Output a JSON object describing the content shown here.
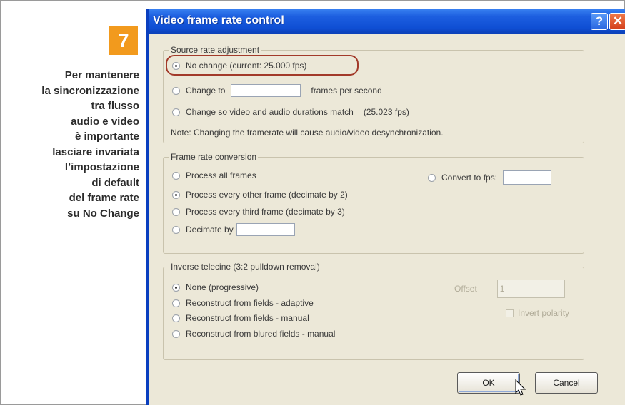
{
  "callout": {
    "number": "7",
    "caption_lines": [
      "Per mantenere",
      "la sincronizzazione",
      "tra flusso",
      "audio e video",
      "è importante",
      "lasciare invariata",
      "l’impostazione",
      "di default",
      "del frame rate",
      "su No Change"
    ]
  },
  "dialog": {
    "title": "Video frame rate control",
    "help_label": "?",
    "close_label": "✕",
    "source": {
      "legend": "Source rate adjustment",
      "no_change": "No change (current: 25.000 fps)",
      "change_to": "Change to",
      "change_to_value": "",
      "change_to_suffix": "frames per second",
      "match": "Change so video and audio durations match",
      "match_value": "(25.023 fps)",
      "note": "Note: Changing the framerate will cause audio/video desynchronization."
    },
    "conversion": {
      "legend": "Frame rate conversion",
      "all_frames": "Process all frames",
      "every_other": "Process every other frame (decimate by 2)",
      "every_third": "Process every third frame (decimate by 3)",
      "decimate_by": "Decimate by",
      "decimate_value": "",
      "convert_to_fps": "Convert to fps:",
      "convert_value": ""
    },
    "telecine": {
      "legend": "Inverse telecine (3:2 pulldown removal)",
      "none": "None (progressive)",
      "adaptive": "Reconstruct from fields - adaptive",
      "manual": "Reconstruct from fields - manual",
      "blurred": "Reconstruct from blured fields - manual",
      "offset_label": "Offset",
      "offset_value": "1",
      "invert_polarity": "Invert polarity"
    },
    "buttons": {
      "ok": "OK",
      "cancel": "Cancel"
    }
  }
}
